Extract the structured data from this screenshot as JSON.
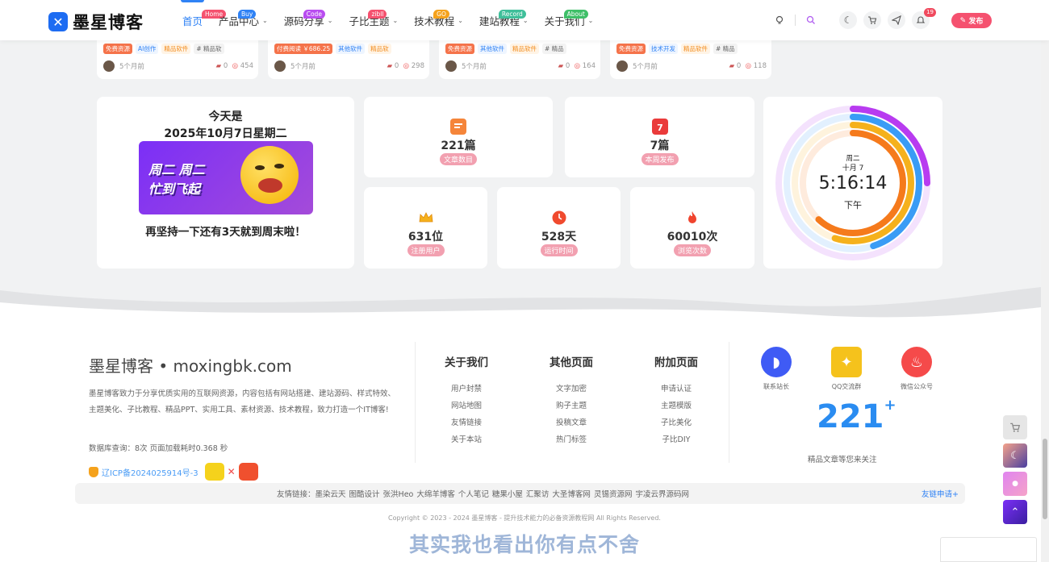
{
  "header": {
    "logo_text": "墨星博客",
    "nav": [
      {
        "label": "首页",
        "badge": "Home",
        "badge_color": "#f5516f",
        "active": true,
        "has_menu": false
      },
      {
        "label": "产品中心",
        "badge": "Buy",
        "badge_color": "#2f82f5",
        "has_menu": true
      },
      {
        "label": "源码分享",
        "badge": "Code",
        "badge_color": "#b94df0",
        "has_menu": true
      },
      {
        "label": "子比主题",
        "badge": "zibll",
        "badge_color": "#f5516f",
        "has_menu": true
      },
      {
        "label": "技术教程",
        "badge": "GO",
        "badge_color": "#f5a21c",
        "has_menu": true
      },
      {
        "label": "建站教程",
        "badge": "Record",
        "badge_color": "#3fbf9a",
        "has_menu": true
      },
      {
        "label": "关于我们",
        "badge": "About",
        "badge_color": "#3fbf68",
        "has_menu": true
      }
    ],
    "notification_count": "19",
    "publish_label": "发布"
  },
  "cards": [
    {
      "tags": [
        "免费资源",
        "AI创作",
        "精品软件",
        "# 精品软"
      ],
      "time": "5个月前",
      "comments": "0",
      "views": "454"
    },
    {
      "tags": [
        "付费阅读 ￥686.25",
        "其他软件",
        "精品软"
      ],
      "time": "5个月前",
      "comments": "0",
      "views": "298"
    },
    {
      "tags": [
        "免费资源",
        "其他软件",
        "精品软件",
        "# 精品"
      ],
      "time": "5个月前",
      "comments": "0",
      "views": "164"
    },
    {
      "tags": [
        "免费资源",
        "技术开发",
        "精品软件",
        "# 精品"
      ],
      "time": "5个月前",
      "comments": "0",
      "views": "118"
    }
  ],
  "today": {
    "title": "今天是",
    "date": "2025年10月7日星期二",
    "banner_line1": "周二 周二",
    "banner_line2": "忙到飞起",
    "footer": "再坚持一下还有3天就到周末啦！"
  },
  "stats": {
    "articles": {
      "value": "221篇",
      "label": "文章数目",
      "icon": "document-icon"
    },
    "week": {
      "value": "7篇",
      "label": "本周发布",
      "icon": "calendar-icon"
    },
    "users": {
      "value": "631位",
      "label": "注册用户",
      "icon": "crown-icon"
    },
    "runtime": {
      "value": "528天",
      "label": "运行时间",
      "icon": "clock-icon"
    },
    "views": {
      "value": "60010次",
      "label": "浏览次数",
      "icon": "fire-icon"
    }
  },
  "clock": {
    "weekday": "周二",
    "month_day": "十月 7",
    "time": "5:16:14",
    "ampm": "下午",
    "ring_colors": [
      "#b83bf0",
      "#3a9cf5",
      "#f5b11c",
      "#f57a1c"
    ]
  },
  "footer": {
    "site_title": "墨星博客 • moxingbk.com",
    "description": "墨星博客致力于分享优质实用的互联网资源，内容包括有网站搭建、建站源码、样式特效、主题美化、子比教程、精品PPT、实用工具、素材资源、技术教程，致力打造一个IT博客!",
    "db_info": "数据库查询：8次 页面加载耗时0.368 秒",
    "icp": "辽ICP备2024025914号-3",
    "columns": [
      {
        "title": "关于我们",
        "items": [
          "用户封禁",
          "网站地图",
          "友情链接",
          "关于本站"
        ]
      },
      {
        "title": "其他页面",
        "items": [
          "文字加密",
          "购子主题",
          "投稿文章",
          "热门标签"
        ]
      },
      {
        "title": "附加页面",
        "items": [
          "申请认证",
          "主题模版",
          "子比美化",
          "子比DIY"
        ]
      }
    ],
    "social": [
      {
        "label": "联系站长",
        "color": "#3f5bf5"
      },
      {
        "label": "QQ交流群",
        "color": "#f5c21c"
      },
      {
        "label": "微信公众号",
        "color": "#f54a4a"
      }
    ],
    "big_number": "221",
    "big_plus": "+",
    "big_label": "精品文章等您来关注",
    "links_label": "友情链接：",
    "links": [
      "墨染云天",
      "图酷设计",
      "张洪Heo",
      "大绵羊博客",
      "个人笔记",
      "糖果小屋",
      "汇聚访",
      "大圣博客网",
      "灵锡资源网",
      "宇凌云界源码网"
    ],
    "links_apply": "友链申请+",
    "copyright": "Copyright © 2023 - 2024 墨星博客 - 提升技术能力的必备资源教程网 All Rights Reserved.",
    "subtitle": "其实我也看出你有点不舍"
  }
}
